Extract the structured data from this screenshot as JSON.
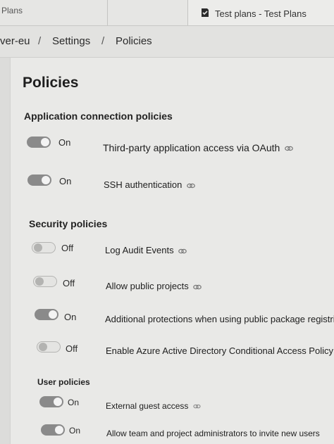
{
  "browser": {
    "left_tab": "Plans",
    "active_tab": "Test plans - Test Plans"
  },
  "breadcrumb": {
    "org": "ver-eu",
    "settings": "Settings",
    "current": "Policies",
    "separator": "/"
  },
  "page": {
    "title": "Policies"
  },
  "sections": {
    "application": {
      "title": "Application connection policies",
      "items": [
        {
          "state": "On",
          "label": "Third-party application access via OAuth"
        },
        {
          "state": "On",
          "label": "SSH authentication"
        }
      ]
    },
    "security": {
      "title": "Security policies",
      "items": [
        {
          "state": "Off",
          "label": "Log Audit Events"
        },
        {
          "state": "Off",
          "label": "Allow public projects"
        },
        {
          "state": "On",
          "label": "Additional protections when using public package registri"
        },
        {
          "state": "Off",
          "label": "Enable Azure Active Directory Conditional Access Policy Va"
        }
      ]
    },
    "user": {
      "title": "User policies",
      "items": [
        {
          "state": "On",
          "label": "External guest access"
        },
        {
          "state": "On",
          "label": "Allow team and project administrators to invite new users"
        }
      ]
    }
  },
  "icons": {
    "link": "link-icon",
    "app": "test-plans-icon"
  }
}
